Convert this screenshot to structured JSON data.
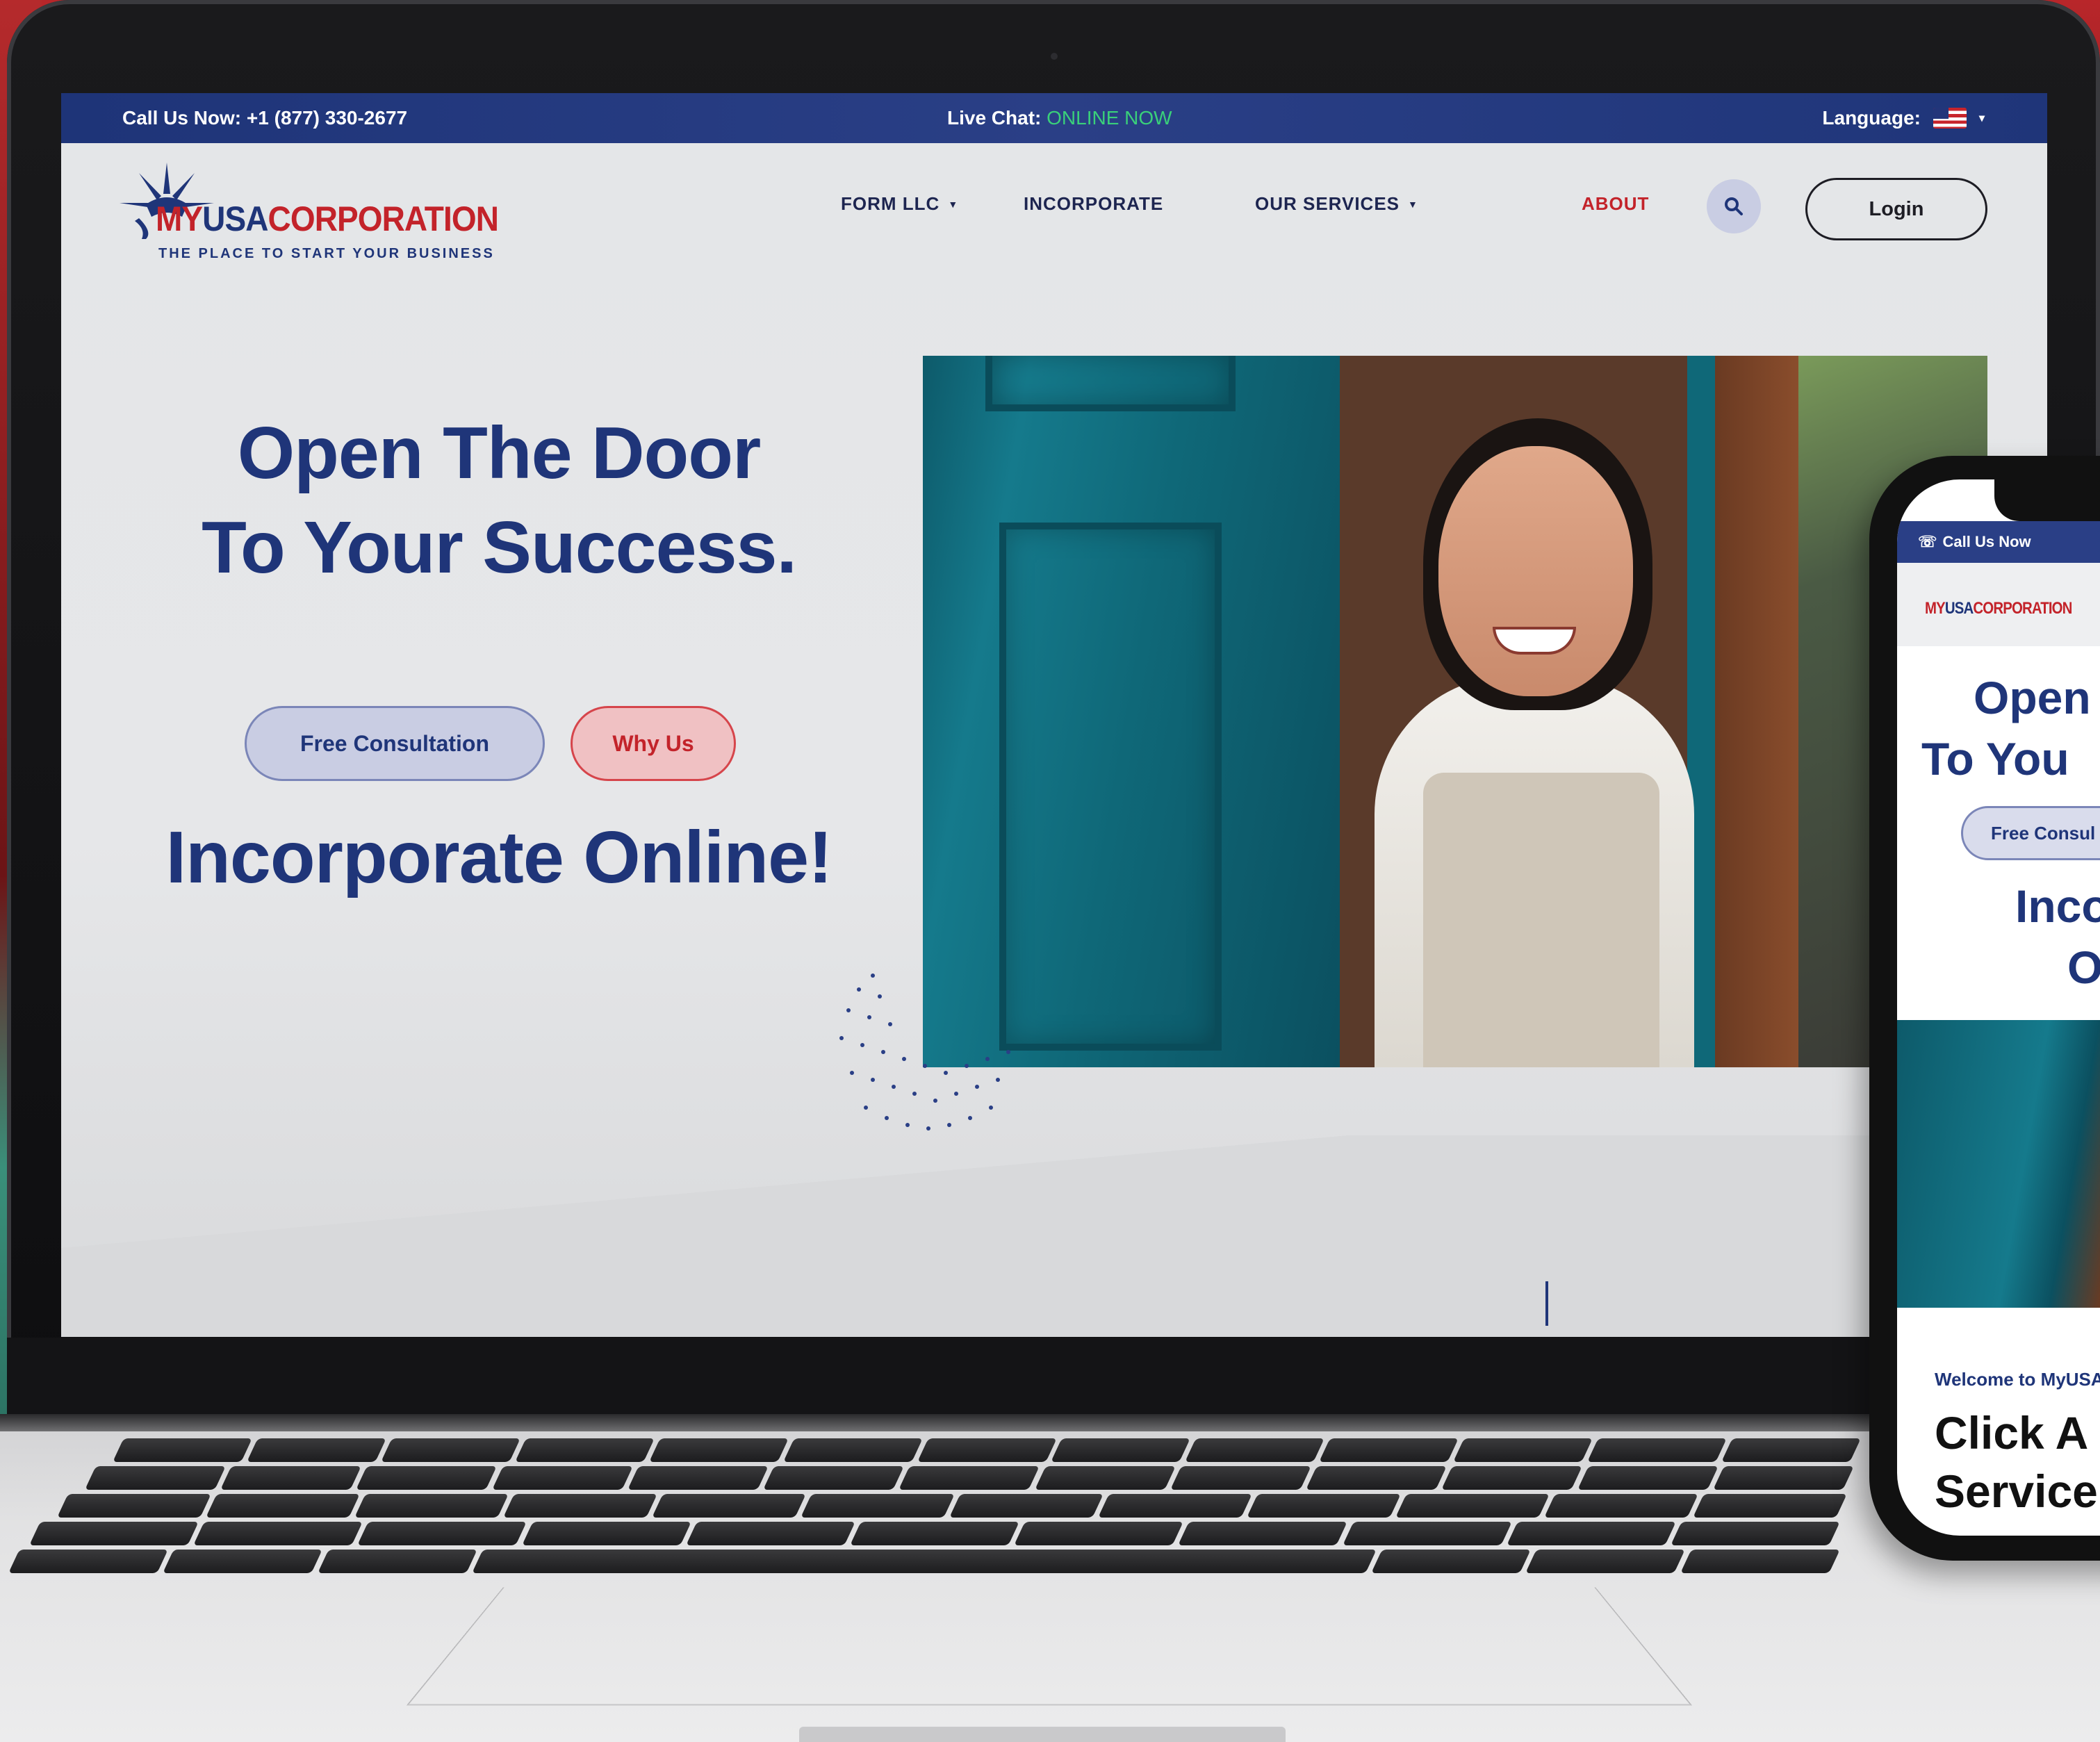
{
  "topbar": {
    "call_label": "Call Us Now: +1 (877) 330-2677",
    "chat_label": "Live Chat:",
    "chat_status": "ONLINE NOW",
    "language_label": "Language:",
    "language_flag": "us-flag-icon"
  },
  "logo": {
    "my": "MY",
    "usa": "USA",
    "corp": "CORPORATION",
    "tagline": "THE PLACE TO START YOUR BUSINESS"
  },
  "nav": {
    "items": [
      {
        "label": "FORM LLC",
        "has_dropdown": true
      },
      {
        "label": "INCORPORATE",
        "has_dropdown": false
      },
      {
        "label": "OUR SERVICES",
        "has_dropdown": true
      },
      {
        "label": "ABOUT",
        "has_dropdown": false,
        "active": true
      }
    ],
    "search_icon": "search-icon",
    "login_label": "Login"
  },
  "hero": {
    "headline_line1": "Open The Door",
    "headline_line2": "To Your Success.",
    "primary_button": "Free Consultation",
    "secondary_button": "Why Us",
    "subheadline": "Incorporate Online!"
  },
  "phone": {
    "topbar_label": "Call Us Now",
    "logo_my": "MY",
    "logo_usa": "USA",
    "logo_corp": "CORPORATION",
    "headline_line1": "Open",
    "headline_line2": "To You",
    "button": "Free Consul",
    "sub_line1": "Inco",
    "sub_line2": "O",
    "welcome": "Welcome to MyUSA",
    "section_line1": "Click A",
    "section_line2": "Service"
  },
  "colors": {
    "brand_navy": "#1f3579",
    "brand_red": "#c3232a",
    "online_green": "#3ad07a"
  }
}
